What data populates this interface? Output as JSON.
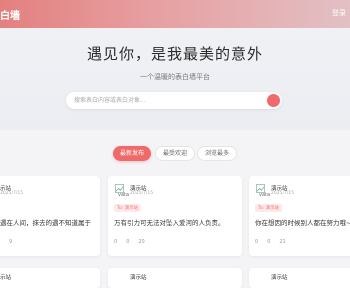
{
  "header": {
    "logo": "白墙",
    "login": "登录"
  },
  "hero": {
    "title": "遇见你，是我最美的意外",
    "subtitle": "一个温暖的表白墙平台",
    "search_placeholder": "搜索表白内容或表白对象..."
  },
  "tabs": [
    {
      "label": "最新发布",
      "active": true
    },
    {
      "label": "最受欢迎",
      "active": false
    },
    {
      "label": "浏览最多",
      "active": false
    }
  ],
  "cards": [
    {
      "author": "示站",
      "date": "2025/7/15",
      "tag": "",
      "content": "遇在人间，抹去的遇不知道属于",
      "stats": [
        "",
        "9"
      ]
    },
    {
      "author": "演示站",
      "date": "2025/7/15",
      "avatar_alt": "vata",
      "tag": "To: 演示站",
      "content": "万有引力可无法对坠入爱河的人负责。",
      "stats": [
        "0",
        "0",
        "20"
      ]
    },
    {
      "author": "演示站",
      "date": "2025/7/15",
      "avatar_alt": "vata",
      "tag": "To: 演示站",
      "content": "你在想因的时候别人都在努力哦~?",
      "stats": [
        "0",
        "0",
        "21"
      ]
    }
  ],
  "cards_row2": [
    {
      "author": "示站"
    },
    {
      "author": "演示站"
    },
    {
      "author": "演示站"
    }
  ],
  "colors": {
    "accent": "#ef6a6a",
    "header_start": "#e3807f"
  }
}
